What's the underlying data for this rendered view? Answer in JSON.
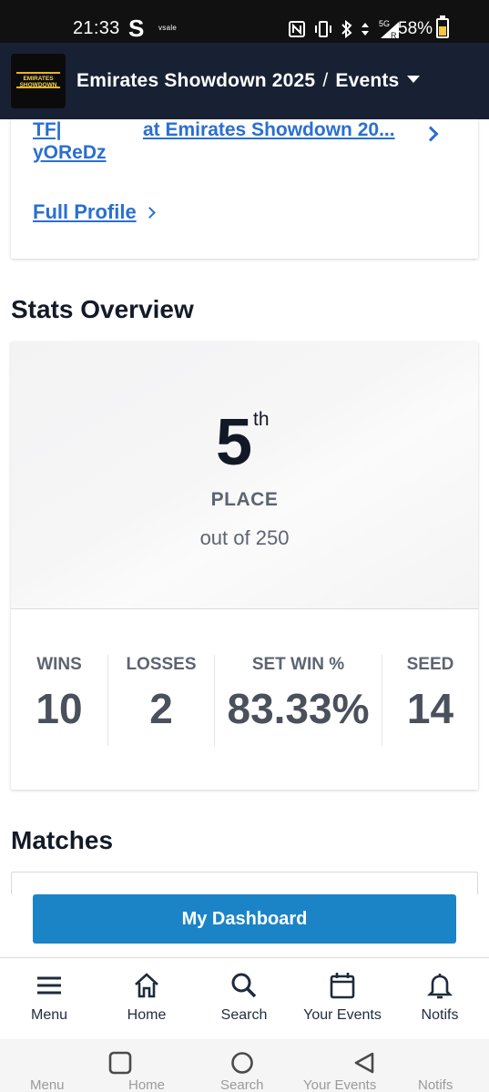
{
  "status_bar": {
    "time": "21:33",
    "carrier_glyph": "S",
    "vsale": "vsale",
    "battery_percent": "58%",
    "icons": [
      "nfc-icon",
      "vibrate-icon",
      "bluetooth-icon",
      "data-arrows-icon",
      "signal-5g-icon",
      "battery-icon"
    ]
  },
  "header": {
    "logo_text": "EMIRATES SHOWDOWN",
    "event_name": "Emirates Showdown 2025",
    "separator": "/",
    "section": "Events"
  },
  "profile_card": {
    "name_line_top": "TF|",
    "name": "yOReDz",
    "event_link": "at Emirates Showdown 20...",
    "full_profile": "Full Profile"
  },
  "stats": {
    "title": "Stats Overview",
    "place_number": "5",
    "place_suffix": "th",
    "place_label": "PLACE",
    "out_of": "out of 250",
    "columns": [
      {
        "label": "WINS",
        "value": "10"
      },
      {
        "label": "LOSSES",
        "value": "2"
      },
      {
        "label": "SET WIN %",
        "value": "83.33%"
      },
      {
        "label": "SEED",
        "value": "14"
      }
    ]
  },
  "matches": {
    "title": "Matches"
  },
  "dashboard_button": "My Dashboard",
  "bottom_nav": [
    {
      "label": "Menu",
      "icon": "menu-icon"
    },
    {
      "label": "Home",
      "icon": "home-icon"
    },
    {
      "label": "Search",
      "icon": "search-icon"
    },
    {
      "label": "Your Events",
      "icon": "calendar-icon"
    },
    {
      "label": "Notifs",
      "icon": "bell-icon"
    }
  ],
  "android_nav": {
    "ghost_labels": [
      "Menu",
      "Home",
      "Search",
      "Your Events",
      "Notifs"
    ]
  },
  "colors": {
    "header_bg": "#182034",
    "link": "#2a6fd1",
    "primary_button": "#1b84c6"
  }
}
